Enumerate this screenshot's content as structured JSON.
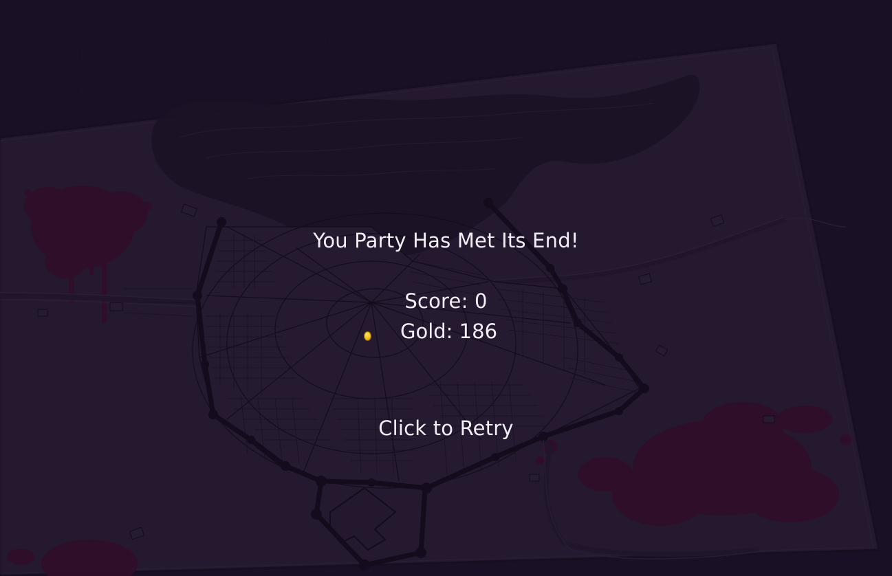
{
  "game_over": {
    "title": "You Party Has Met Its End!",
    "score_text": "Score: 0",
    "gold_text": "Gold: 186",
    "retry_text": "Click to Retry"
  },
  "icons": {
    "coin": "gold-coin-icon"
  },
  "colors": {
    "background": "#1e1429",
    "map_paper": "#2a1f36",
    "map_lines": "#140d1c",
    "blood": "#3a0f2e",
    "text": "#f2eef6",
    "coin": "#f0b90b"
  }
}
